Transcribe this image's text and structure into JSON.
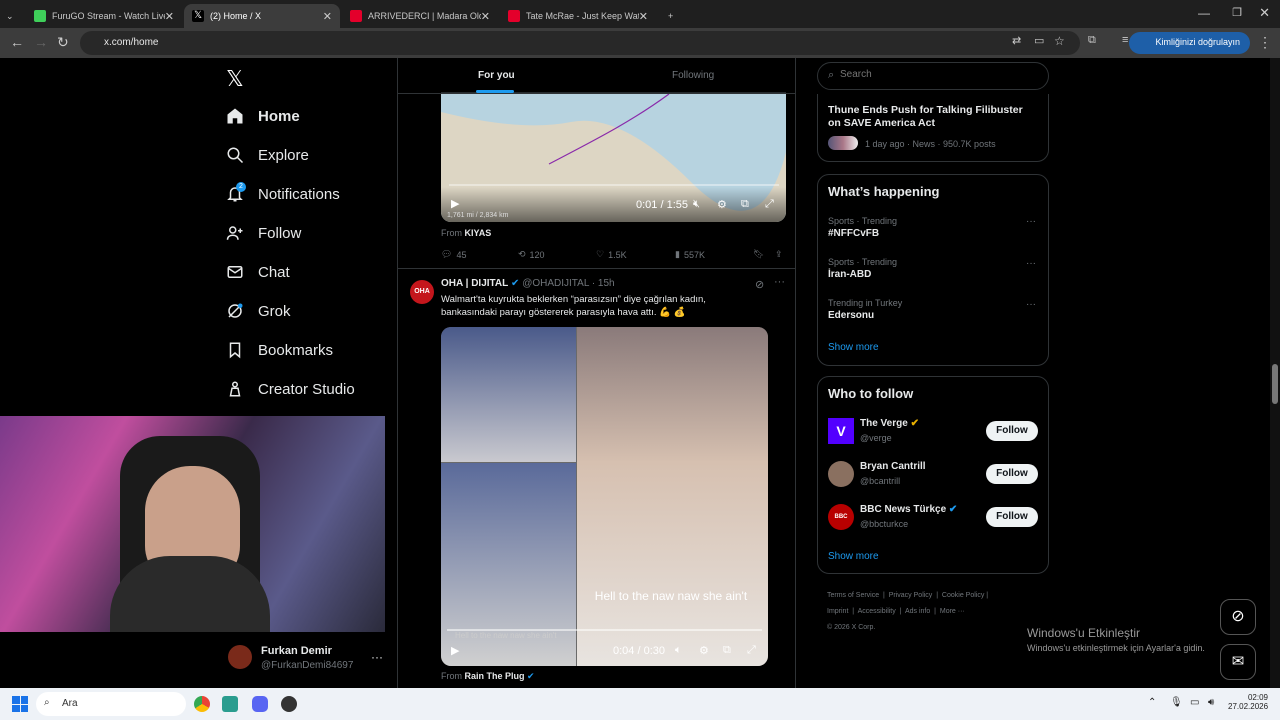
{
  "browser": {
    "tabs": [
      {
        "label": "FuruGO Stream - Watch Live or",
        "color": "#3fcf5a"
      },
      {
        "label": "(2) Home / X",
        "color": "#ffffff"
      },
      {
        "label": "ARRIVEDERCI | Madara Olduk #",
        "color": "#e4002b"
      },
      {
        "label": "Tate McRae - Just Keep Watchin",
        "color": "#e4002b"
      }
    ],
    "url": "x.com/home",
    "verify_label": "Kimliğinizi doğrulayın"
  },
  "nav": {
    "items": [
      "Home",
      "Explore",
      "Notifications",
      "Follow",
      "Chat",
      "Grok",
      "Bookmarks",
      "Creator Studio"
    ],
    "notif_badge": "2"
  },
  "account": {
    "name": "Furkan Demir",
    "handle": "@FurkanDemi84697"
  },
  "feed": {
    "tabs": [
      "For you",
      "Following"
    ],
    "post1": {
      "video_time": "0:01 / 1:55",
      "video_label": "1,761 mi / 2,834 km",
      "from_label": "From",
      "from_name": "KIYAS",
      "replies": "45",
      "reposts": "120",
      "likes": "1.5K",
      "views": "557K"
    },
    "post2": {
      "avatar": "OHA",
      "name": "OHA | DIJITAL",
      "handle": "@OHADIJITAL",
      "time": "· 15h",
      "text": "Walmart'ta kuyrukta beklerken “parasızsın” diye çağrılan kadın, bankasındaki parayı göstererek parasıyla hava attı. 💪 💰",
      "caption": "Hell to the naw naw she ain't",
      "caption_small": "Hell to the naw naw she ain't",
      "video_time": "0:04 / 0:30",
      "from_label": "From",
      "from_name": "Rain The Plug"
    }
  },
  "search": {
    "placeholder": "Search"
  },
  "trend_top": {
    "title": "Thune Ends Push for Talking Filibuster on SAVE America Act",
    "meta": "1 day ago · News · 950.7K posts"
  },
  "happening": {
    "title": "What’s happening",
    "items": [
      {
        "meta": "Sports · Trending",
        "name": "#NFFCvFB"
      },
      {
        "meta": "Sports · Trending",
        "name": "İran-ABD"
      },
      {
        "meta": "Trending in Turkey",
        "name": "Edersonu"
      }
    ],
    "show_more": "Show more"
  },
  "who": {
    "title": "Who to follow",
    "items": [
      {
        "name": "The Verge",
        "handle": "@verge",
        "btn": "Follow"
      },
      {
        "name": "Bryan Cantrill",
        "handle": "@bcantrill",
        "btn": "Follow"
      },
      {
        "name": "BBC News Türkçe",
        "handle": "@bbcturkce",
        "btn": "Follow"
      }
    ],
    "show_more": "Show more"
  },
  "footer": {
    "links": [
      "Terms of Service",
      "Privacy Policy",
      "Cookie Policy",
      "Imprint",
      "Accessibility",
      "Ads info",
      "More ···"
    ],
    "copy": "© 2026 X Corp."
  },
  "watermark": {
    "title": "Windows'u Etkinleştir",
    "sub": "Windows'u etkinleştirmek için Ayarlar'a gidin."
  },
  "taskbar": {
    "search": "Ara",
    "time": "02:09",
    "date": "27.02.2026"
  },
  "colors": {
    "accent": "#1d9bf0",
    "bg": "#000000"
  }
}
